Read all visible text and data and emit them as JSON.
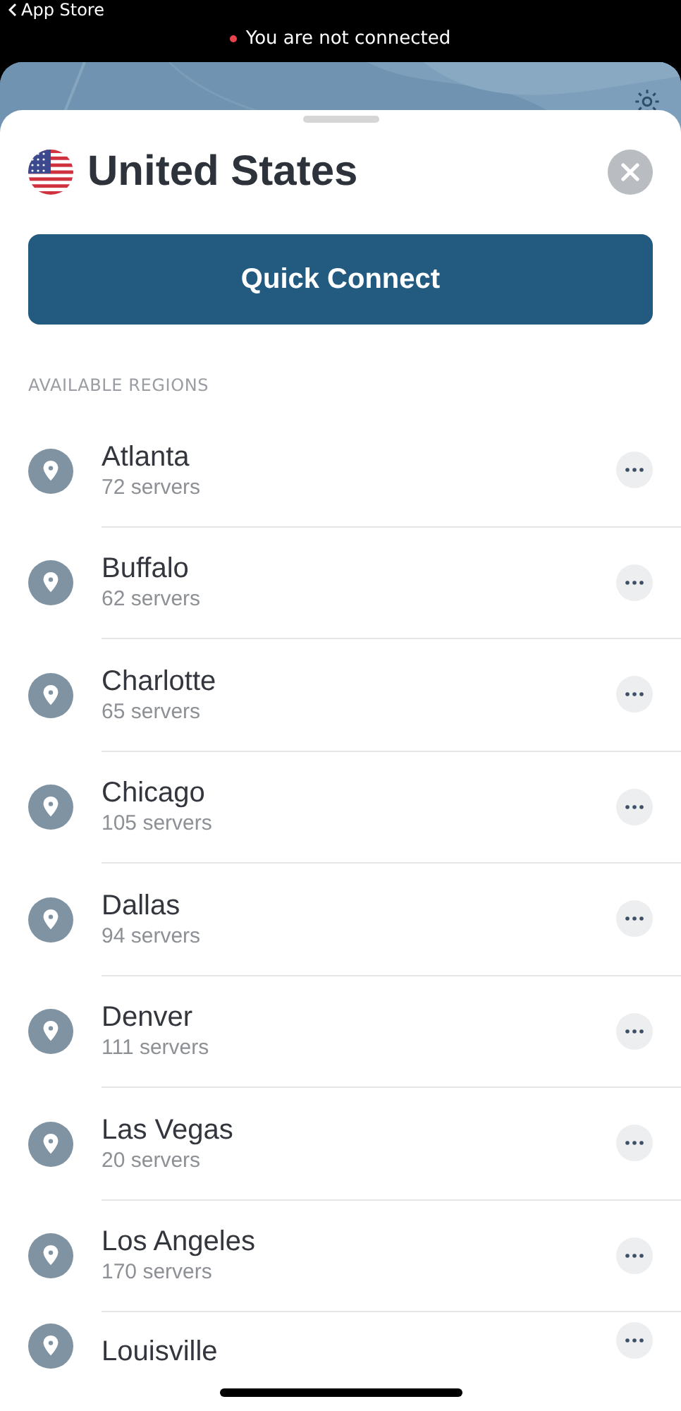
{
  "status_bar": {
    "back_label": "App Store",
    "connection_status": "You are not connected",
    "connected": false
  },
  "sheet": {
    "country": "United States",
    "quick_connect": "Quick Connect",
    "section_title": "AVAILABLE REGIONS",
    "regions": [
      {
        "name": "Atlanta",
        "servers": "72 servers"
      },
      {
        "name": "Buffalo",
        "servers": "62 servers"
      },
      {
        "name": "Charlotte",
        "servers": "65 servers"
      },
      {
        "name": "Chicago",
        "servers": "105 servers"
      },
      {
        "name": "Dallas",
        "servers": "94 servers"
      },
      {
        "name": "Denver",
        "servers": "111 servers"
      },
      {
        "name": "Las Vegas",
        "servers": "20 servers"
      },
      {
        "name": "Los Angeles",
        "servers": "170 servers"
      },
      {
        "name": "Louisville"
      }
    ]
  }
}
